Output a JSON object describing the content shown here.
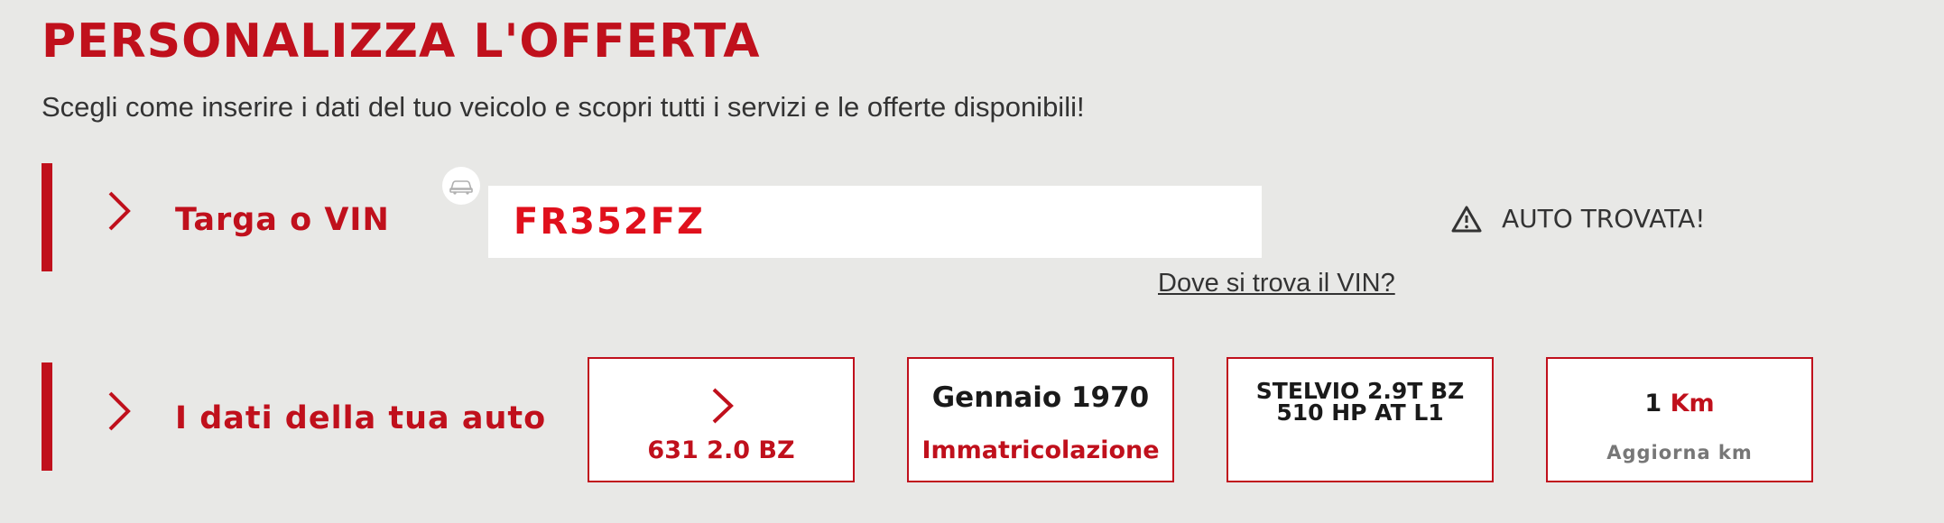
{
  "header": {
    "title": "PERSONALIZZA L'OFFERTA",
    "subtitle": "Scegli come inserire i dati del tuo veicolo e scopri tutti i servizi e le offerte disponibili!"
  },
  "plate_row": {
    "label": "Targa o VIN",
    "input_value": "FR352FZ",
    "status_text": "AUTO TROVATA!",
    "vin_help_link": "Dove si trova il VIN?"
  },
  "car_row": {
    "label": "I dati della tua auto",
    "engine_card": {
      "value": "631 2.0 BZ"
    },
    "registration_card": {
      "date": "Gennaio 1970",
      "caption": "Immatricolazione"
    },
    "model_card": {
      "model": "STELVIO 2.9T BZ 510 HP AT L1"
    },
    "mileage_card": {
      "number": "1",
      "unit": "Km",
      "action": "Aggiorna km"
    }
  },
  "colors": {
    "brand_red": "#c0101c",
    "background": "#e8e8e6",
    "text_dark": "#333333"
  },
  "icons": [
    "chevron-right-icon",
    "car-icon",
    "warning-triangle-icon"
  ]
}
